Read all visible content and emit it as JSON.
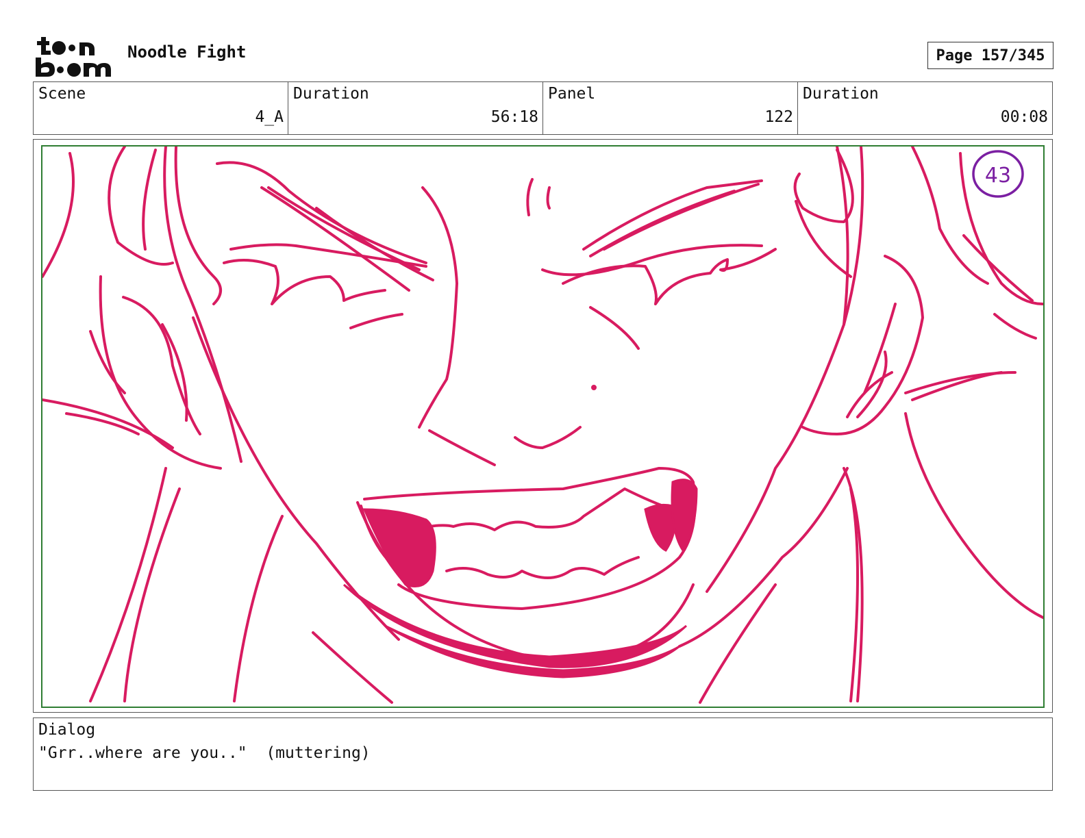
{
  "header": {
    "logo_text": "toon boom",
    "project_title": "Noodle Fight",
    "page_label": "Page 157/345"
  },
  "info": [
    {
      "label": "Scene",
      "value": "4_A"
    },
    {
      "label": "Duration",
      "value": "56:18"
    },
    {
      "label": "Panel",
      "value": "122"
    },
    {
      "label": "Duration",
      "value": "00:08"
    }
  ],
  "panel": {
    "marker": "43",
    "sketch_color": "#d81b60",
    "marker_color": "#7b1fa2",
    "frame_color": "#2e7d32"
  },
  "dialog": {
    "label": "Dialog",
    "text": "\"Grr..where are you..\"  (muttering)"
  }
}
